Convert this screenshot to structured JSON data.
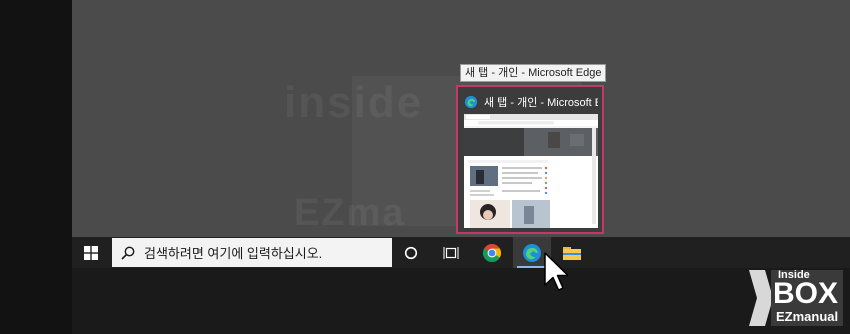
{
  "tooltip": {
    "text": "새 탭 - 개인 - Microsoft Edge"
  },
  "preview": {
    "title": "새 탭 - 개인 - Microsoft Edge",
    "accent": "#c2386a"
  },
  "taskbar": {
    "search_placeholder": "검색하려면 여기에 입력하십시오.",
    "icons": [
      "windows-start-icon",
      "search-icon",
      "cortana-circle-icon",
      "task-view-icon",
      "chrome-icon",
      "edge-icon",
      "file-explorer-icon"
    ]
  },
  "watermark": {
    "text1": "inside",
    "text2": "EZma"
  },
  "logo": {
    "line1": "Inside",
    "line2": "BOX",
    "line3": "EZmanual"
  },
  "colors": {
    "highlight_border": "#c2386a",
    "edge_underline": "#8fb8e6"
  }
}
